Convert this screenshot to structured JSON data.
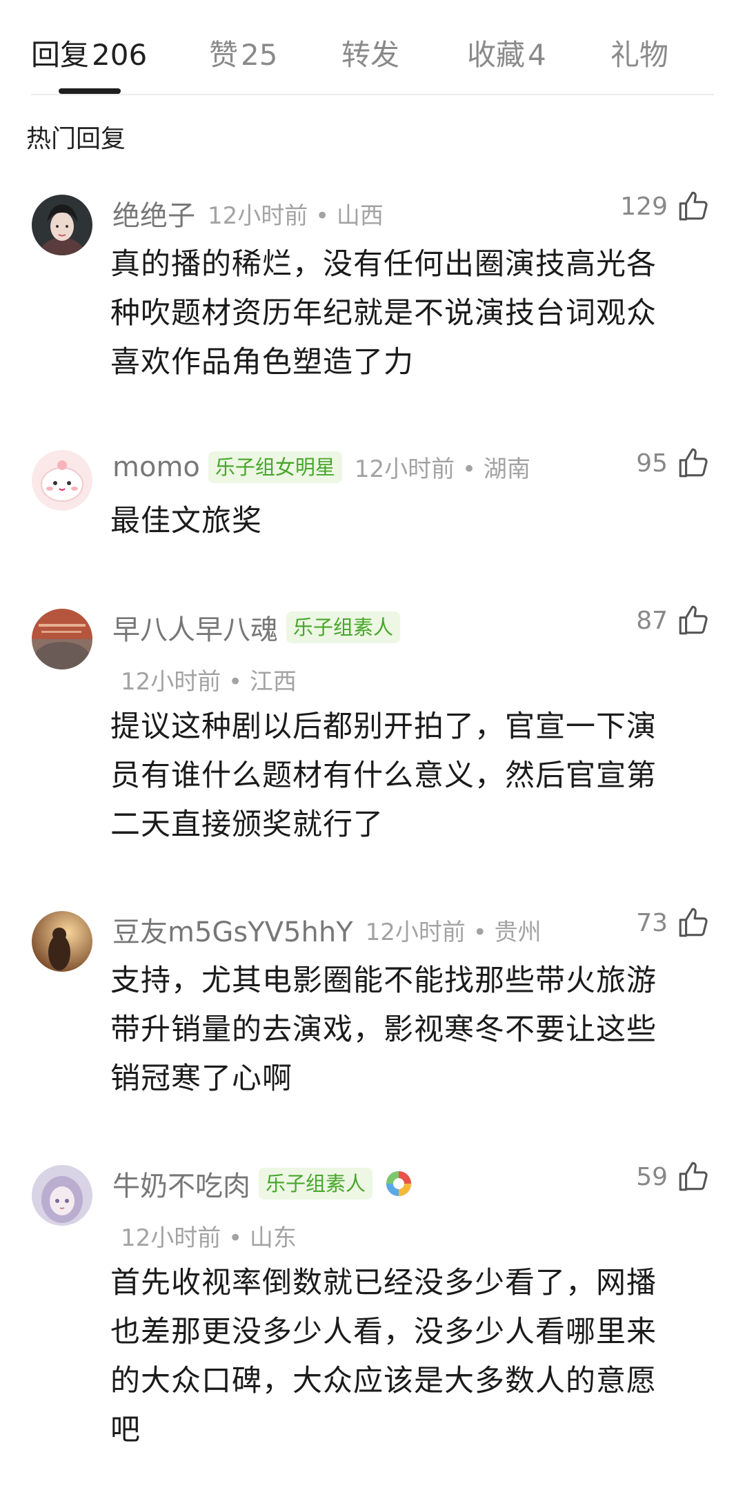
{
  "tabs": [
    {
      "label": "回复",
      "count": "206"
    },
    {
      "label": "赞",
      "count": "25"
    },
    {
      "label": "转发",
      "count": ""
    },
    {
      "label": "收藏",
      "count": "4"
    },
    {
      "label": "礼物",
      "count": ""
    }
  ],
  "section_title": "热门回复",
  "comments": [
    {
      "name": "绝绝子",
      "badge": "",
      "time": "12小时前 • 山西",
      "likes": "129",
      "lines": [
        "真的播的稀烂，没有任何出圈演技高光各",
        "种吹题材资历年纪就是不说演技台词观众",
        "喜欢作品角色塑造了力"
      ]
    },
    {
      "name": "momo",
      "badge": "乐子组女明星",
      "time": "12小时前 • 湖南",
      "likes": "95",
      "lines": [
        "最佳文旅奖"
      ]
    },
    {
      "name": "早八人早八魂",
      "badge": "乐子组素人",
      "time": "12小时前 • 江西",
      "likes": "87",
      "lines": [
        "提议这种剧以后都别开拍了，官宣一下演",
        "员有谁什么题材有什么意义，然后官宣第",
        "二天直接颁奖就行了"
      ]
    },
    {
      "name": "豆友m5GsYV5hhY",
      "badge": "",
      "time": "12小时前 • 贵州",
      "likes": "73",
      "lines": [
        "支持，尤其电影圈能不能找那些带火旅游",
        "带升销量的去演戏，影视寒冬不要让这些",
        "销冠寒了心啊"
      ]
    },
    {
      "name": "牛奶不吃肉",
      "badge": "乐子组素人",
      "time": "12小时前 • 山东",
      "likes": "59",
      "lines": [
        "首先收视率倒数就已经没多少看了，网播",
        "也差那更没多少人看，没多少人看哪里来",
        "的大众口碑，大众应该是大多数人的意愿",
        "吧"
      ]
    }
  ],
  "colors": {
    "badge_text": "#47a62a",
    "badge_bg": "#edf7e4",
    "meta_gray": "#a3a3a3",
    "active_tab": "#1f1f1f"
  }
}
